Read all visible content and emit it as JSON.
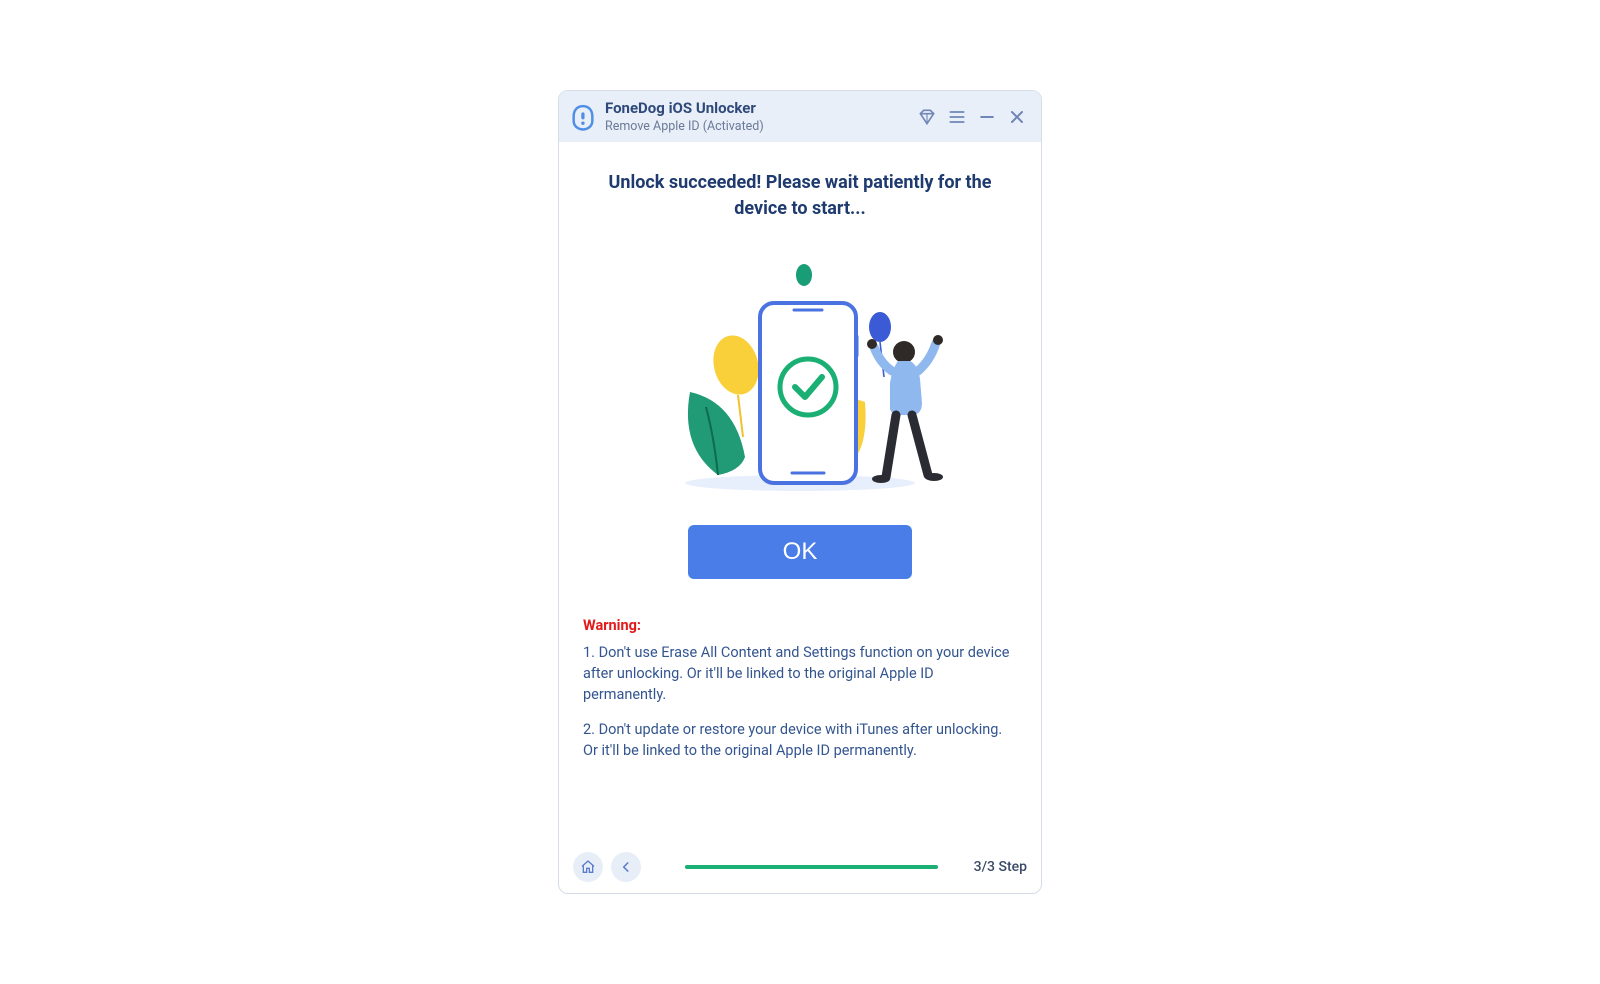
{
  "header": {
    "app_title": "FoneDog iOS Unlocker",
    "subtitle": "Remove Apple ID  (Activated)"
  },
  "main": {
    "heading": "Unlock succeeded! Please wait patiently for the device to start...",
    "ok_label": "OK"
  },
  "warning": {
    "label": "Warning:",
    "items": [
      "1. Don't use Erase All Content and Settings function on your device after unlocking. Or it'll be linked to the original Apple ID permanently.",
      "2. Don't update or restore your device with iTunes after unlocking. Or it'll be linked to the original Apple ID permanently."
    ]
  },
  "footer": {
    "step_label": "3/3 Step",
    "progress_percent": 100
  },
  "icons": {
    "diamond": "diamond-icon",
    "menu": "menu-icon",
    "minimize": "minimize-icon",
    "close": "close-icon",
    "home": "home-icon",
    "back": "back-icon"
  },
  "colors": {
    "accent_blue": "#4a7de8",
    "text_navy": "#1e3a6e",
    "warn_red": "#e21a1a",
    "progress_green": "#1aaf73"
  }
}
